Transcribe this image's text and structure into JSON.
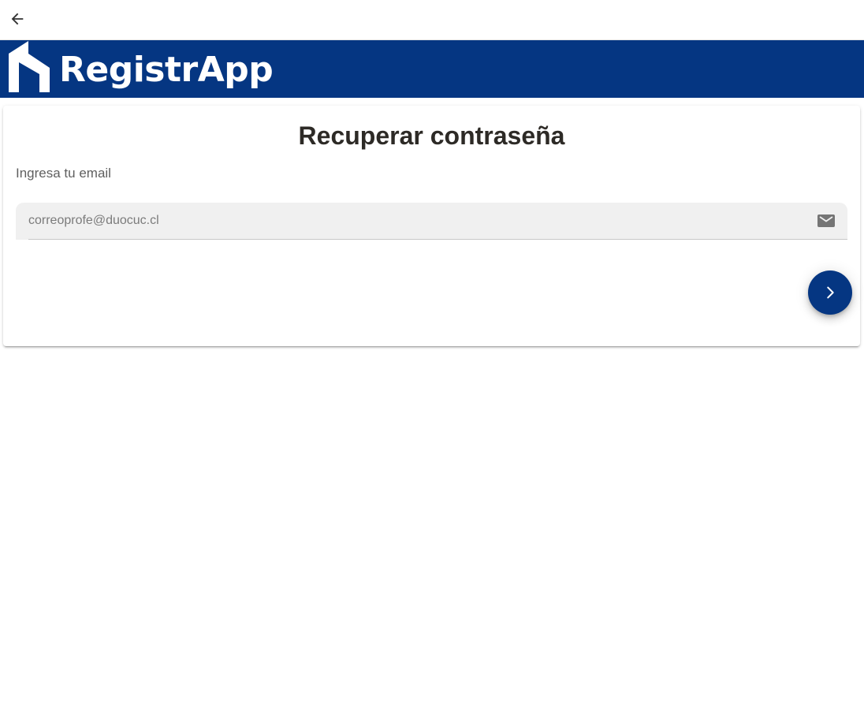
{
  "header": {
    "back_icon": "arrow-back-icon"
  },
  "brand": {
    "logo_text": "RegistrApp",
    "color": "#053682"
  },
  "card": {
    "title": "Recuperar contraseña",
    "label": "Ingresa tu email",
    "email_input": {
      "value": "",
      "placeholder": "correoprofe@duocuc.cl",
      "icon": "mail-icon"
    },
    "submit_icon": "chevron-forward-icon"
  },
  "colors": {
    "accent": "#053682",
    "input_background": "#f0f0f0",
    "title_text": "#2d2a26"
  }
}
